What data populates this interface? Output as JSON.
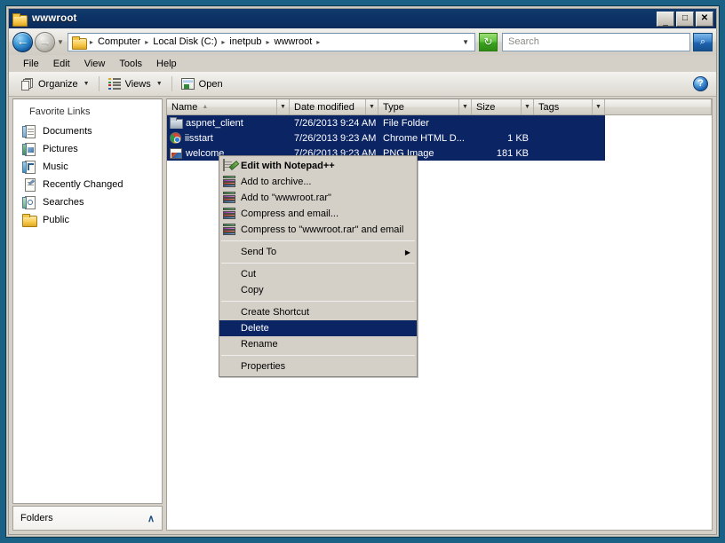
{
  "window": {
    "title": "wwwroot",
    "title_icon": "folder-icon",
    "buttons": {
      "minimize": "_",
      "maximize": "□",
      "close": "✕"
    }
  },
  "addressbar": {
    "back_icon": "back-arrow-icon",
    "forward_icon": "forward-arrow-icon",
    "history_caret": "▼",
    "folder_icon": "folder-icon",
    "separator": "▸",
    "crumbs": [
      "Computer",
      "Local Disk (C:)",
      "inetpub",
      "wwwroot"
    ],
    "overflow_caret": "▼",
    "refresh_icon": "refresh-icon",
    "refresh_glyph": "↻",
    "search": {
      "placeholder": "Search",
      "value": "",
      "go_icon": "search-icon",
      "go_glyph": "⌕"
    }
  },
  "menubar": {
    "items": [
      "File",
      "Edit",
      "View",
      "Tools",
      "Help"
    ]
  },
  "toolbar": {
    "organize": {
      "label": "Organize",
      "icon": "organize-icon",
      "caret": "▼"
    },
    "views": {
      "label": "Views",
      "icon": "views-icon",
      "caret": "▼"
    },
    "open": {
      "label": "Open",
      "icon": "open-icon"
    },
    "help": {
      "label": "?",
      "icon": "help-icon"
    }
  },
  "sidebar": {
    "title": "Favorite Links",
    "items": [
      {
        "label": "Documents",
        "icon": "documents-icon"
      },
      {
        "label": "Pictures",
        "icon": "pictures-icon"
      },
      {
        "label": "Music",
        "icon": "music-icon"
      },
      {
        "label": "Recently Changed",
        "icon": "recently-changed-icon"
      },
      {
        "label": "Searches",
        "icon": "searches-icon"
      },
      {
        "label": "Public",
        "icon": "folder-icon"
      }
    ],
    "folders_bar": {
      "label": "Folders",
      "chevron": "∧"
    }
  },
  "filelist": {
    "columns": [
      {
        "label": "Name",
        "sort": "▲"
      },
      {
        "label": "Date modified",
        "sort": ""
      },
      {
        "label": "Type",
        "sort": ""
      },
      {
        "label": "Size",
        "sort": ""
      },
      {
        "label": "Tags",
        "sort": ""
      }
    ],
    "column_caret": "▼",
    "rows": [
      {
        "name": "aspnet_client",
        "date": "7/26/2013 9:24 AM",
        "type": "File Folder",
        "size": "",
        "tags": "",
        "icon": "folder-icon",
        "selected": true
      },
      {
        "name": "iisstart",
        "date": "7/26/2013 9:23 AM",
        "type": "Chrome HTML D...",
        "size": "1 KB",
        "tags": "",
        "icon": "chrome-html-document-icon",
        "selected": true
      },
      {
        "name": "welcome",
        "date": "7/26/2013 9:23 AM",
        "type": "PNG Image",
        "size": "181 KB",
        "tags": "",
        "icon": "png-image-icon",
        "selected": true
      }
    ]
  },
  "context_menu": {
    "items": [
      {
        "label": "Edit with Notepad++",
        "icon": "notepadpp-icon",
        "bold": true,
        "type": "item"
      },
      {
        "label": "Add to archive...",
        "icon": "winrar-icon",
        "type": "item"
      },
      {
        "label": "Add to \"wwwroot.rar\"",
        "icon": "winrar-icon",
        "type": "item"
      },
      {
        "label": "Compress and email...",
        "icon": "winrar-icon",
        "type": "item"
      },
      {
        "label": "Compress to \"wwwroot.rar\" and email",
        "icon": "winrar-icon",
        "type": "item"
      },
      {
        "type": "separator"
      },
      {
        "label": "Send To",
        "type": "submenu",
        "arrow": "▶"
      },
      {
        "type": "separator"
      },
      {
        "label": "Cut",
        "type": "item"
      },
      {
        "label": "Copy",
        "type": "item"
      },
      {
        "type": "separator"
      },
      {
        "label": "Create Shortcut",
        "type": "item"
      },
      {
        "label": "Delete",
        "type": "item",
        "highlighted": true
      },
      {
        "label": "Rename",
        "type": "item"
      },
      {
        "type": "separator"
      },
      {
        "label": "Properties",
        "type": "item"
      }
    ]
  },
  "colors": {
    "desktop": "#1b6185",
    "titlebar": "#0d3366",
    "selection": "#0b2464",
    "chrome": "#d4d0c8"
  }
}
